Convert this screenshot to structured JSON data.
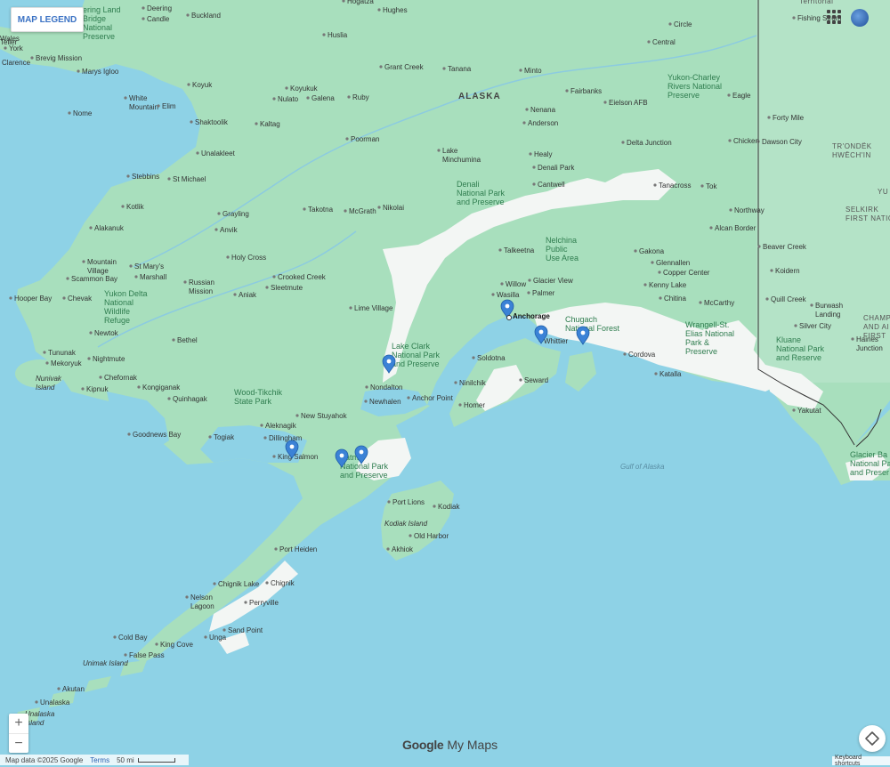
{
  "ui": {
    "legend_button": "MAP LEGEND",
    "zoom_in": "+",
    "zoom_out": "−",
    "brand_google": "Google",
    "brand_product": "My Maps",
    "map_data": "Map data ©2025 Google",
    "terms": "Terms",
    "scale": "50 mi",
    "keyboard_shortcuts": "Keyboard shortcuts"
  },
  "colors": {
    "water": "#8ed2e6",
    "land": "#a8dfbd",
    "snow": "#f5f7f6",
    "marker": "#3b82d6",
    "border": "#333333"
  },
  "map": {
    "region": "ALASKA",
    "places": [
      {
        "id": "hogatza",
        "text": "Hogatza"
      },
      {
        "id": "hughes",
        "text": "Hughes"
      },
      {
        "id": "deering",
        "text": "Deering"
      },
      {
        "id": "candle",
        "text": "Candle"
      },
      {
        "id": "buckland",
        "text": "Buckland"
      },
      {
        "id": "huslia",
        "text": "Huslia"
      },
      {
        "id": "wales",
        "text": "Wales"
      },
      {
        "id": "york",
        "text": "York"
      },
      {
        "id": "teller",
        "text": "Teller"
      },
      {
        "id": "brevig",
        "text": "Brevig Mission"
      },
      {
        "id": "clarence",
        "text": "Clarence"
      },
      {
        "id": "marys",
        "text": "Marys Igloo"
      },
      {
        "id": "koyuk",
        "text": "Koyuk"
      },
      {
        "id": "grantcreek",
        "text": "Grant Creek"
      },
      {
        "id": "tanana",
        "text": "Tanana"
      },
      {
        "id": "minto",
        "text": "Minto"
      },
      {
        "id": "circle",
        "text": "Circle"
      },
      {
        "id": "central",
        "text": "Central"
      },
      {
        "id": "fishing",
        "text": "Fishing Strom"
      },
      {
        "id": "koyukuk",
        "text": "Koyukuk"
      },
      {
        "id": "nulato",
        "text": "Nulato"
      },
      {
        "id": "galena",
        "text": "Galena"
      },
      {
        "id": "ruby",
        "text": "Ruby"
      },
      {
        "id": "fairbanks",
        "text": "Fairbanks"
      },
      {
        "id": "eielson",
        "text": "Eielson AFB"
      },
      {
        "id": "eagle",
        "text": "Eagle"
      },
      {
        "id": "white",
        "text": "White Mountain"
      },
      {
        "id": "elim",
        "text": "Elim"
      },
      {
        "id": "nome",
        "text": "Nome"
      },
      {
        "id": "shaktoolik",
        "text": "Shaktoolik"
      },
      {
        "id": "kaltag",
        "text": "Kaltag"
      },
      {
        "id": "nenana",
        "text": "Nenana"
      },
      {
        "id": "anderson",
        "text": "Anderson"
      },
      {
        "id": "fortymile",
        "text": "Forty Mile"
      },
      {
        "id": "dawson",
        "text": "Dawson City"
      },
      {
        "id": "poorman",
        "text": "Poorman"
      },
      {
        "id": "delta",
        "text": "Delta Junction"
      },
      {
        "id": "chicken",
        "text": "Chicken"
      },
      {
        "id": "unalakleet",
        "text": "Unalakleet"
      },
      {
        "id": "lakeminchumina",
        "text": "Lake Minchumina"
      },
      {
        "id": "healy",
        "text": "Healy"
      },
      {
        "id": "denalipark_town",
        "text": "Denali Park"
      },
      {
        "id": "stebbins",
        "text": "Stebbins"
      },
      {
        "id": "stmichael",
        "text": "St Michael"
      },
      {
        "id": "cantwell",
        "text": "Cantwell"
      },
      {
        "id": "tanacross",
        "text": "Tanacross"
      },
      {
        "id": "tok",
        "text": "Tok"
      },
      {
        "id": "kotlik",
        "text": "Kotlik"
      },
      {
        "id": "takotna",
        "text": "Takotna"
      },
      {
        "id": "mcgrath",
        "text": "McGrath"
      },
      {
        "id": "nikolai",
        "text": "Nikolai"
      },
      {
        "id": "northway",
        "text": "Northway"
      },
      {
        "id": "grayling",
        "text": "Grayling"
      },
      {
        "id": "alakanuk",
        "text": "Alakanuk"
      },
      {
        "id": "anvik",
        "text": "Anvik"
      },
      {
        "id": "alcan",
        "text": "Alcan Border"
      },
      {
        "id": "talkeetna",
        "text": "Talkeetna"
      },
      {
        "id": "gakona",
        "text": "Gakona"
      },
      {
        "id": "beaver",
        "text": "Beaver Creek"
      },
      {
        "id": "mountain",
        "text": "Mountain Village"
      },
      {
        "id": "stmarys",
        "text": "St Mary's"
      },
      {
        "id": "holycross",
        "text": "Holy Cross"
      },
      {
        "id": "glennallen",
        "text": "Glennallen"
      },
      {
        "id": "koidern",
        "text": "Koidern"
      },
      {
        "id": "scammon",
        "text": "Scammon Bay"
      },
      {
        "id": "marshall",
        "text": "Marshall"
      },
      {
        "id": "crooked",
        "text": "Crooked Creek"
      },
      {
        "id": "copper",
        "text": "Copper Center"
      },
      {
        "id": "russian",
        "text": "Russian Mission"
      },
      {
        "id": "sleetmute",
        "text": "Sleetmute"
      },
      {
        "id": "kenny",
        "text": "Kenny Lake"
      },
      {
        "id": "willow",
        "text": "Willow"
      },
      {
        "id": "wasilla",
        "text": "Wasilla"
      },
      {
        "id": "palmer",
        "text": "Palmer"
      },
      {
        "id": "glacier",
        "text": "Glacier View"
      },
      {
        "id": "hooper",
        "text": "Hooper Bay"
      },
      {
        "id": "chevak",
        "text": "Chevak"
      },
      {
        "id": "aniak",
        "text": "Aniak"
      },
      {
        "id": "chitina",
        "text": "Chitina"
      },
      {
        "id": "quill",
        "text": "Quill Creek"
      },
      {
        "id": "burwash",
        "text": "Burwash Landing"
      },
      {
        "id": "anchorage",
        "text": "Anchorage"
      },
      {
        "id": "limevillage",
        "text": "Lime Village"
      },
      {
        "id": "mccarthy",
        "text": "McCarthy"
      },
      {
        "id": "silver",
        "text": "Silver City"
      },
      {
        "id": "whittier",
        "text": "Whittier"
      },
      {
        "id": "newtok",
        "text": "Newtok"
      },
      {
        "id": "bethel",
        "text": "Bethel"
      },
      {
        "id": "haines",
        "text": "Haines Junction"
      },
      {
        "id": "tununak",
        "text": "Tununak"
      },
      {
        "id": "nightmute",
        "text": "Nightmute"
      },
      {
        "id": "cordova",
        "text": "Cordova"
      },
      {
        "id": "mekoryuk",
        "text": "Mekoryuk"
      },
      {
        "id": "soldotna",
        "text": "Soldotna"
      },
      {
        "id": "chefornak",
        "text": "Chefornak"
      },
      {
        "id": "katalla",
        "text": "Katalla"
      },
      {
        "id": "nondalton",
        "text": "Nondalton"
      },
      {
        "id": "ninilchik",
        "text": "Ninilchik"
      },
      {
        "id": "seward",
        "text": "Seward"
      },
      {
        "id": "kipnuk",
        "text": "Kipnuk"
      },
      {
        "id": "kongiganak",
        "text": "Kongiganak"
      },
      {
        "id": "quinhagak",
        "text": "Quinhagak"
      },
      {
        "id": "anchorpoint",
        "text": "Anchor Point"
      },
      {
        "id": "newhalen",
        "text": "Newhalen"
      },
      {
        "id": "homer",
        "text": "Homer"
      },
      {
        "id": "yakutat",
        "text": "Yakutat"
      },
      {
        "id": "newstuyahok",
        "text": "New Stuyahok"
      },
      {
        "id": "goodnews",
        "text": "Goodnews Bay"
      },
      {
        "id": "aleknagik",
        "text": "Aleknagik"
      },
      {
        "id": "togiak",
        "text": "Togiak"
      },
      {
        "id": "dillingham",
        "text": "Dillingham"
      },
      {
        "id": "kingsalmon",
        "text": "King Salmon"
      },
      {
        "id": "portlions",
        "text": "Port Lions"
      },
      {
        "id": "kodiak",
        "text": "Kodiak"
      },
      {
        "id": "oldharbor",
        "text": "Old Harbor"
      },
      {
        "id": "akhiok",
        "text": "Akhiok"
      },
      {
        "id": "portheiden",
        "text": "Port Heiden"
      },
      {
        "id": "chignik",
        "text": "Chignik"
      },
      {
        "id": "chigniklake",
        "text": "Chignik Lake"
      },
      {
        "id": "perryville",
        "text": "Perryville"
      },
      {
        "id": "nelson",
        "text": "Nelson Lagoon"
      },
      {
        "id": "sandpoint",
        "text": "Sand Point"
      },
      {
        "id": "unga",
        "text": "Unga"
      },
      {
        "id": "coldbay",
        "text": "Cold Bay"
      },
      {
        "id": "kingcove",
        "text": "King Cove"
      },
      {
        "id": "falsepass",
        "text": "False Pass"
      },
      {
        "id": "akutan",
        "text": "Akutan"
      },
      {
        "id": "unalaska",
        "text": "Unalaska"
      }
    ],
    "parks": [
      {
        "id": "bering",
        "lines": [
          "ering Land",
          "Bridge",
          "National",
          "Preserve"
        ]
      },
      {
        "id": "yukoncharley",
        "lines": [
          "Yukon-Charley",
          "Rivers National",
          "Preserve"
        ]
      },
      {
        "id": "denali",
        "lines": [
          "Denali",
          "National Park",
          "and Preserve"
        ]
      },
      {
        "id": "nelchina",
        "lines": [
          "Nelchina",
          "Public",
          "Use Area"
        ]
      },
      {
        "id": "yukondelta",
        "lines": [
          "Yukon Delta",
          "National",
          "Wildlife",
          "Refuge"
        ]
      },
      {
        "id": "chugach",
        "lines": [
          "Chugach",
          "National Forest"
        ]
      },
      {
        "id": "wrangell",
        "lines": [
          "Wrangell-St.",
          "Elias National",
          "Park &",
          "Preserve"
        ]
      },
      {
        "id": "kluane",
        "lines": [
          "Kluane",
          "National Park",
          "and Reserve"
        ]
      },
      {
        "id": "lakeclark",
        "lines": [
          "Lake Clark",
          "National Park",
          "and Preserve"
        ]
      },
      {
        "id": "woodtikchik",
        "lines": [
          "Wood-Tikchik",
          "State Park"
        ]
      },
      {
        "id": "katmai",
        "lines": [
          "Katmai",
          "National Park",
          "and Preserve"
        ]
      },
      {
        "id": "glacierbay",
        "lines": [
          "Glacier Ba",
          "National Pa",
          "and Preser"
        ]
      }
    ],
    "islands": [
      {
        "id": "nunivak",
        "lines": [
          "Nunivak",
          "Island"
        ]
      },
      {
        "id": "kodiakisl",
        "lines": [
          "Kodiak Island"
        ]
      },
      {
        "id": "unimak",
        "lines": [
          "Unimak Island"
        ]
      },
      {
        "id": "unalaskaisl",
        "lines": [
          "Unalaska",
          "Island"
        ]
      }
    ],
    "water": [
      {
        "id": "gulf",
        "text": "Gulf of Alaska"
      }
    ],
    "territories": [
      {
        "id": "territorial",
        "lines": [
          "Territorial"
        ]
      },
      {
        "id": "trondek",
        "lines": [
          "TR'ONDËK",
          "HWËCH'IN"
        ]
      },
      {
        "id": "selkirk",
        "lines": [
          "SELKIRK",
          "FIRST NATIO"
        ]
      },
      {
        "id": "champagne",
        "lines": [
          "CHAMP",
          "AND AI",
          "FIRST"
        ]
      },
      {
        "id": "yu",
        "lines": [
          "YU"
        ]
      }
    ]
  }
}
